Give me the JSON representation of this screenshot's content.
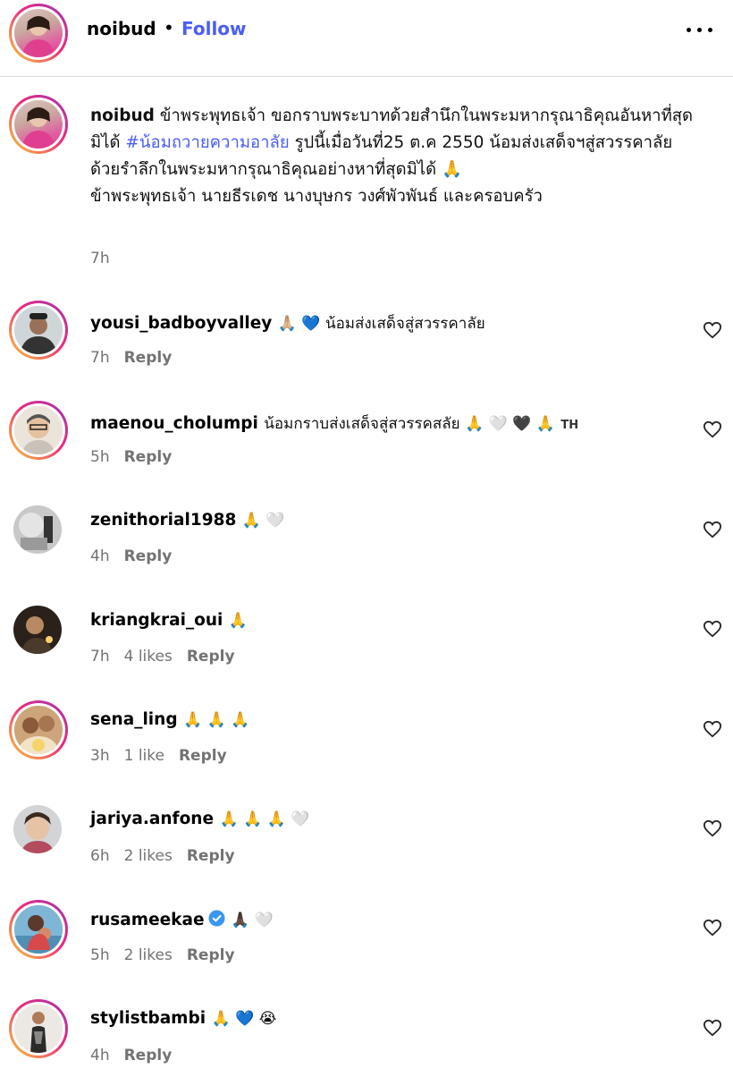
{
  "header": {
    "username": "noibud",
    "separator": "•",
    "follow_label": "Follow",
    "more_icon": "more-horizontal-icon"
  },
  "caption": {
    "username": "noibud",
    "text_1": "ข้าพระพุทธเจ้า ขอกราบพระบาทด้วยสำนึกในพระมหากรุณาธิคุณอันหาที่สุดมิได้",
    "hashtag": "#น้อมถวายความอาลัย",
    "text_2": "รูปนี้เมื่อวันที่25 ต.ค 2550 น้อมส่งเสด็จฯสู่สวรรคาลัย",
    "text_3": "ด้วยรำลึกในพระมหากรุณาธิคุณอย่างหาที่สุดมิได้ 🙏",
    "text_4": "ข้าพระพุทธเจ้า นายธีรเดช นางบุษกร วงศ์พัวพันธ์ และครอบครัว",
    "time": "7h"
  },
  "comments": [
    {
      "username": "yousi_badboyvalley",
      "text": "🙏🏼 💙 น้อมส่งเสด็จสู่สวรรคาลัย",
      "time": "7h",
      "likes": "",
      "reply": "Reply"
    },
    {
      "username": "maenou_cholumpi",
      "text": "น้อมกราบส่งเสด็จสู่สวรรคสลัย 🙏 🤍 🖤 🙏",
      "badge": "TH",
      "time": "5h",
      "likes": "",
      "reply": "Reply"
    },
    {
      "username": "zenithorial1988",
      "text": "🙏 🤍",
      "time": "4h",
      "likes": "",
      "reply": "Reply"
    },
    {
      "username": "kriangkrai_oui",
      "text": "🙏",
      "time": "7h",
      "likes": "4 likes",
      "reply": "Reply"
    },
    {
      "username": "sena_ling",
      "text": "🙏 🙏 🙏",
      "time": "3h",
      "likes": "1 like",
      "reply": "Reply"
    },
    {
      "username": "jariya.anfone",
      "text": "🙏 🙏 🙏 🤍",
      "time": "6h",
      "likes": "2 likes",
      "reply": "Reply"
    },
    {
      "username": "rusameekae",
      "text": "🙏🏿 🤍",
      "verified": true,
      "time": "5h",
      "likes": "2 likes",
      "reply": "Reply"
    },
    {
      "username": "stylistbambi",
      "text": "🙏 💙 😭",
      "time": "4h",
      "likes": "",
      "reply": "Reply"
    }
  ],
  "colors": {
    "link": "#4a5df9",
    "meta": "#737373",
    "divider": "#dbdbdb"
  }
}
